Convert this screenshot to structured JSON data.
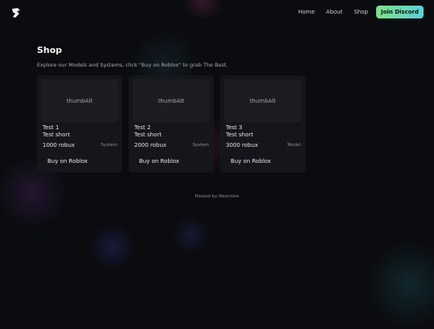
{
  "header": {
    "logo_icon": "bird-logo-icon",
    "nav": {
      "home": "Home",
      "about": "About",
      "shop": "Shop"
    },
    "discord_button": "Join Discord"
  },
  "main": {
    "title": "Shop",
    "subtitle": "Explore our Models and Systems, click \"Buy on Roblox\" to grab The Best.",
    "cards": [
      {
        "thumb": "thumbAlt",
        "title": "Test 1",
        "short": "Test short",
        "price": "1000 robux",
        "type": "System",
        "button": "Buy on Roblox"
      },
      {
        "thumb": "thumbAlt",
        "title": "Test 2",
        "short": "Test short",
        "price": "2000 robux",
        "type": "System",
        "button": "Buy on Roblox"
      },
      {
        "thumb": "thumbAlt",
        "title": "Test 3",
        "short": "Test short",
        "price": "3000 robux",
        "type": "Model",
        "button": "Buy on Roblox"
      }
    ]
  },
  "footer": {
    "text": "Hosted by Neocities"
  },
  "colors": {
    "background": "#0b0c10",
    "accent_start": "#7fe08c",
    "accent_end": "#5ed0d6",
    "card": "#16171c"
  }
}
